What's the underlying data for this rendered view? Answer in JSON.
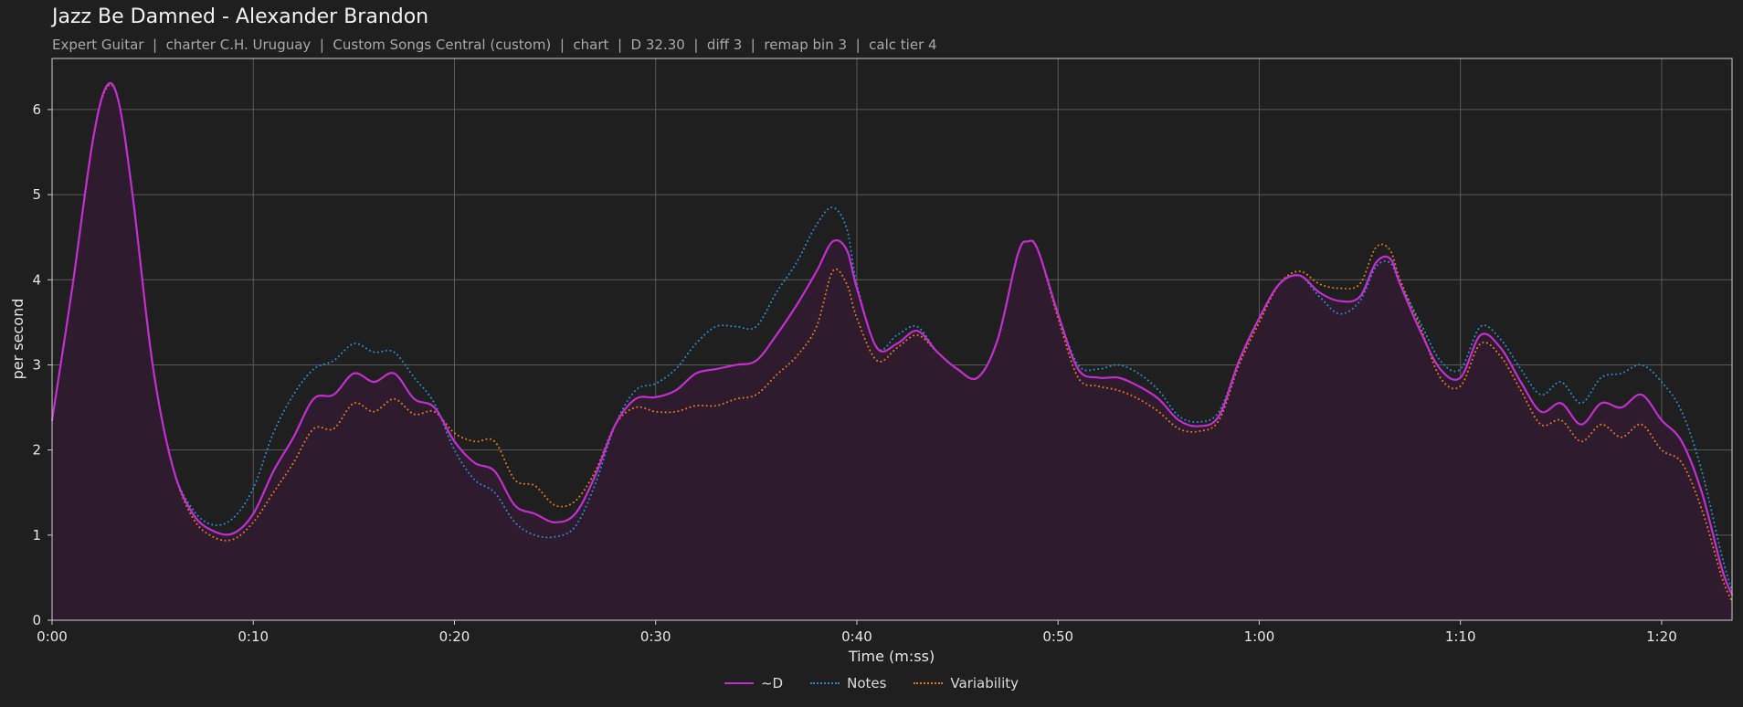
{
  "title": "Jazz Be Damned - Alexander Brandon",
  "subtitle": "Expert Guitar  |  charter C.H. Uruguay  |  Custom Songs Central (custom)  |  chart  |  D 32.30  |  diff 3  |  remap bin 3  |  calc tier 4",
  "colors": {
    "background": "#1f1f1f",
    "d": "#c22fcf",
    "notes": "#2a88c9",
    "variability": "#e0771f",
    "fill": "#2e1c2e",
    "grid": "#5a5a5a"
  },
  "chart_data": {
    "type": "line",
    "xlabel": "Time (m:ss)",
    "ylabel": "per second",
    "xlim": [
      0,
      83.5
    ],
    "ylim": [
      0,
      6.6
    ],
    "x_ticks": [
      {
        "value": 0,
        "label": "0:00"
      },
      {
        "value": 10,
        "label": "0:10"
      },
      {
        "value": 20,
        "label": "0:20"
      },
      {
        "value": 30,
        "label": "0:30"
      },
      {
        "value": 40,
        "label": "0:40"
      },
      {
        "value": 50,
        "label": "0:50"
      },
      {
        "value": 60,
        "label": "1:00"
      },
      {
        "value": 70,
        "label": "1:10"
      },
      {
        "value": 80,
        "label": "1:20"
      }
    ],
    "y_ticks": [
      0,
      1,
      2,
      3,
      4,
      5,
      6
    ],
    "grid": true,
    "legend_position": "bottom-center",
    "series": [
      {
        "name": "~D",
        "style": "solid",
        "color": "#c22fcf",
        "x": [
          0,
          1,
          2,
          2.7,
          3.3,
          4,
          5,
          6,
          7,
          8,
          9,
          10,
          11,
          12,
          13,
          14,
          15,
          16,
          17,
          18,
          19,
          20,
          21,
          22,
          23,
          24,
          25,
          26,
          27,
          28,
          29,
          30,
          31,
          32,
          33,
          34,
          35,
          36,
          37,
          38,
          38.8,
          39.5,
          40,
          41,
          42,
          43,
          44,
          45,
          46,
          47,
          48,
          48.5,
          49,
          50,
          51,
          52,
          53,
          54,
          55,
          56,
          57,
          58,
          59,
          60,
          61,
          62,
          63,
          64,
          65,
          65.8,
          66.5,
          67,
          68,
          69,
          70,
          71,
          72,
          73,
          74,
          75,
          76,
          77,
          78,
          79,
          80,
          81,
          82,
          83,
          83.5
        ],
        "y": [
          2.35,
          3.9,
          5.6,
          6.27,
          6.1,
          5.0,
          3.0,
          1.8,
          1.25,
          1.05,
          1.02,
          1.25,
          1.75,
          2.15,
          2.6,
          2.65,
          2.9,
          2.8,
          2.9,
          2.6,
          2.5,
          2.1,
          1.85,
          1.75,
          1.35,
          1.25,
          1.15,
          1.25,
          1.7,
          2.3,
          2.6,
          2.62,
          2.7,
          2.9,
          2.95,
          3.0,
          3.05,
          3.35,
          3.7,
          4.1,
          4.45,
          4.35,
          3.9,
          3.2,
          3.25,
          3.4,
          3.15,
          2.95,
          2.85,
          3.3,
          4.3,
          4.45,
          4.35,
          3.6,
          2.95,
          2.85,
          2.85,
          2.75,
          2.6,
          2.35,
          2.28,
          2.4,
          3.05,
          3.55,
          3.95,
          4.05,
          3.85,
          3.75,
          3.8,
          4.2,
          4.25,
          3.95,
          3.4,
          2.95,
          2.85,
          3.35,
          3.2,
          2.8,
          2.45,
          2.55,
          2.3,
          2.55,
          2.5,
          2.65,
          2.35,
          2.1,
          1.5,
          0.6,
          0.3
        ]
      },
      {
        "name": "Notes",
        "style": "dotted",
        "color": "#2a88c9",
        "x": [
          0,
          1,
          2,
          2.7,
          3.3,
          4,
          5,
          6,
          7,
          8,
          9,
          10,
          11,
          12,
          13,
          14,
          15,
          16,
          17,
          18,
          19,
          20,
          21,
          22,
          23,
          24,
          25,
          26,
          27,
          28,
          29,
          30,
          31,
          32,
          33,
          34,
          35,
          36,
          37,
          38,
          38.8,
          39.5,
          40,
          41,
          42,
          43,
          44,
          45,
          46,
          47,
          48,
          48.5,
          49,
          50,
          51,
          52,
          53,
          54,
          55,
          56,
          57,
          58,
          59,
          60,
          61,
          62,
          63,
          64,
          65,
          65.8,
          66.5,
          67,
          68,
          69,
          70,
          71,
          72,
          73,
          74,
          75,
          76,
          77,
          78,
          79,
          80,
          81,
          82,
          83,
          83.5
        ],
        "y": [
          2.35,
          3.9,
          5.6,
          6.27,
          6.1,
          5.0,
          3.0,
          1.8,
          1.3,
          1.12,
          1.2,
          1.55,
          2.2,
          2.65,
          2.95,
          3.05,
          3.25,
          3.15,
          3.15,
          2.85,
          2.55,
          2.0,
          1.65,
          1.5,
          1.15,
          1.0,
          0.98,
          1.1,
          1.6,
          2.3,
          2.7,
          2.78,
          2.95,
          3.25,
          3.45,
          3.45,
          3.45,
          3.85,
          4.2,
          4.65,
          4.85,
          4.6,
          3.95,
          3.2,
          3.35,
          3.45,
          3.15,
          2.95,
          2.85,
          3.3,
          4.3,
          4.45,
          4.35,
          3.6,
          3.0,
          2.95,
          3.0,
          2.9,
          2.7,
          2.4,
          2.33,
          2.45,
          3.05,
          3.55,
          3.95,
          4.05,
          3.8,
          3.6,
          3.75,
          4.15,
          4.2,
          3.95,
          3.5,
          3.05,
          2.95,
          3.45,
          3.3,
          2.95,
          2.65,
          2.8,
          2.55,
          2.85,
          2.9,
          3.0,
          2.8,
          2.45,
          1.75,
          0.75,
          0.35
        ]
      },
      {
        "name": "Variability",
        "style": "dotted",
        "color": "#e0771f",
        "x": [
          0,
          1,
          2,
          2.7,
          3.3,
          4,
          5,
          6,
          7,
          8,
          9,
          10,
          11,
          12,
          13,
          14,
          15,
          16,
          17,
          18,
          19,
          20,
          21,
          22,
          23,
          24,
          25,
          26,
          27,
          28,
          29,
          30,
          31,
          32,
          33,
          34,
          35,
          36,
          37,
          38,
          38.8,
          39.5,
          40,
          41,
          42,
          43,
          44,
          45,
          46,
          47,
          48,
          48.5,
          49,
          50,
          51,
          52,
          53,
          54,
          55,
          56,
          57,
          58,
          59,
          60,
          61,
          62,
          63,
          64,
          65,
          65.8,
          66.5,
          67,
          68,
          69,
          70,
          71,
          72,
          73,
          74,
          75,
          76,
          77,
          78,
          79,
          80,
          81,
          82,
          83,
          83.5
        ],
        "y": [
          2.35,
          3.9,
          5.6,
          6.25,
          6.1,
          5.0,
          3.0,
          1.8,
          1.2,
          0.98,
          0.95,
          1.15,
          1.5,
          1.85,
          2.25,
          2.25,
          2.55,
          2.45,
          2.6,
          2.42,
          2.45,
          2.2,
          2.1,
          2.1,
          1.65,
          1.58,
          1.35,
          1.4,
          1.75,
          2.3,
          2.5,
          2.45,
          2.45,
          2.52,
          2.52,
          2.6,
          2.65,
          2.88,
          3.1,
          3.45,
          4.1,
          3.95,
          3.55,
          3.05,
          3.2,
          3.35,
          3.15,
          2.95,
          2.85,
          3.3,
          4.3,
          4.45,
          4.35,
          3.55,
          2.85,
          2.75,
          2.7,
          2.6,
          2.45,
          2.25,
          2.22,
          2.35,
          3.0,
          3.5,
          3.95,
          4.1,
          3.95,
          3.9,
          3.95,
          4.38,
          4.35,
          4.0,
          3.45,
          2.85,
          2.75,
          3.25,
          3.1,
          2.7,
          2.3,
          2.35,
          2.1,
          2.3,
          2.15,
          2.3,
          2.0,
          1.85,
          1.3,
          0.5,
          0.22
        ]
      }
    ]
  }
}
